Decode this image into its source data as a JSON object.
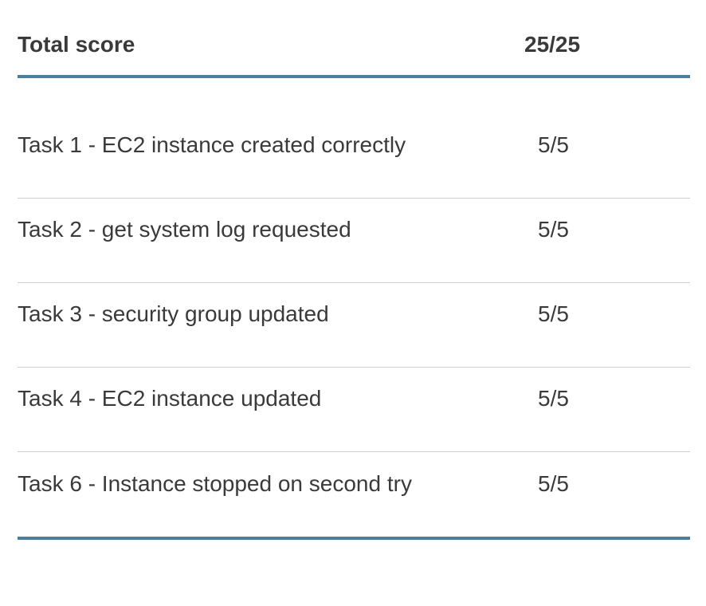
{
  "summary": {
    "label": "Total score",
    "value": "25/25"
  },
  "tasks": [
    {
      "label": "Task 1 - EC2 instance created correctly",
      "score": "5/5"
    },
    {
      "label": "Task 2 - get system log requested",
      "score": "5/5"
    },
    {
      "label": "Task 3 - security group updated",
      "score": "5/5"
    },
    {
      "label": "Task 4 - EC2 instance updated",
      "score": "5/5"
    },
    {
      "label": "Task 6 - Instance stopped on second try",
      "score": "5/5"
    }
  ],
  "colors": {
    "accent_rule": "#4a7f9e",
    "row_divider": "#cfcfcf",
    "text": "#3a3a3a"
  }
}
